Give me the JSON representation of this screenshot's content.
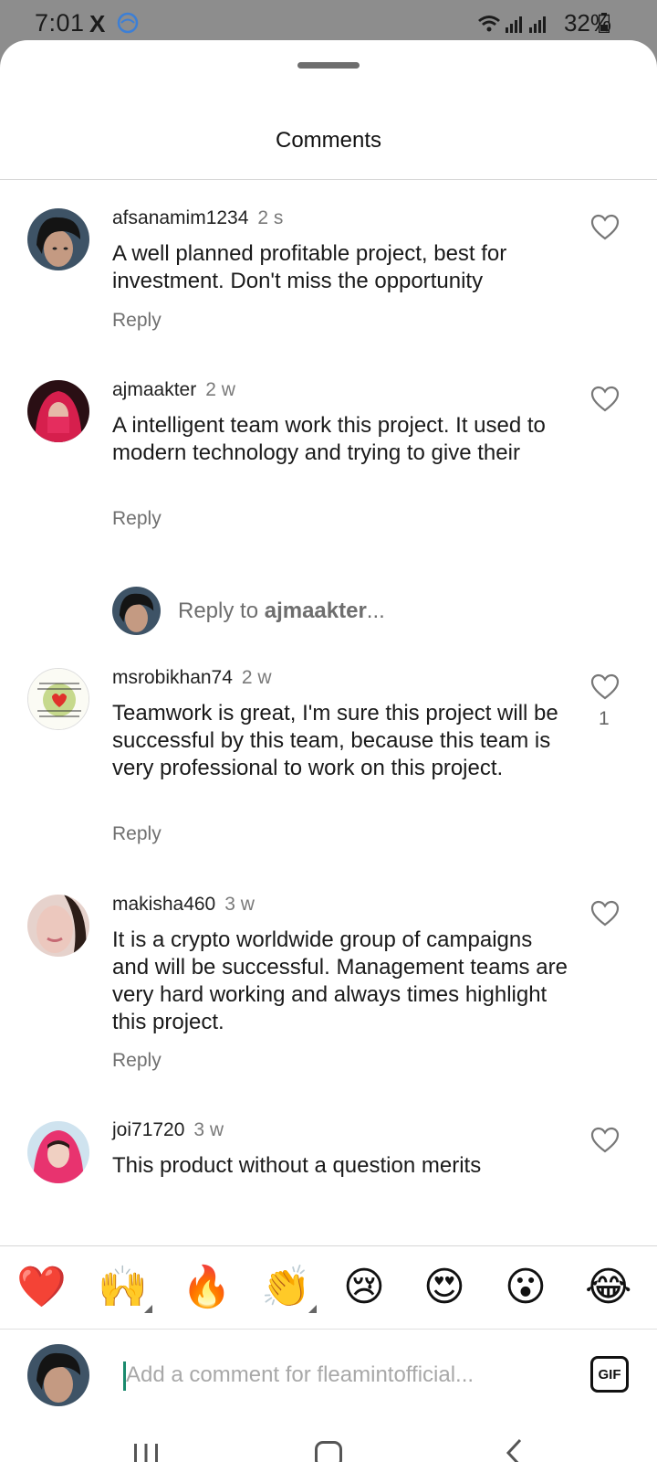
{
  "status_bar": {
    "time": "7:01",
    "x_icon": "X",
    "battery_percent": "32%",
    "icons": [
      "x-logo-icon",
      "browser-icon",
      "wifi-icon",
      "signal-icon",
      "signal-icon",
      "battery-icon"
    ]
  },
  "sheet": {
    "title": "Comments"
  },
  "comments": [
    {
      "username": "afsanamim1234",
      "time": "2 s",
      "text": "A well planned profitable project, best for investment. Don't miss the opportunity",
      "reply_label": "Reply",
      "likes": ""
    },
    {
      "username": "ajmaakter",
      "time": "2 w",
      "text": "A intelligent team work this project. It used to modern technology and trying to give their",
      "reply_label": "Reply",
      "likes": ""
    },
    {
      "username": "msrobikhan74",
      "time": "2 w",
      "text": "Teamwork is great, I'm sure this project will be successful by this team, because this team is very professional to work on this project.",
      "reply_label": "Reply",
      "likes": "1"
    },
    {
      "username": "makisha460",
      "time": "3 w",
      "text": "It is a crypto worldwide group of campaigns and will be successful. Management teams are very hard working and always times highlight this project.",
      "reply_label": "Reply",
      "likes": ""
    },
    {
      "username": "joi71720",
      "time": "3 w",
      "text": "This product without a question merits",
      "reply_label": "",
      "likes": ""
    }
  ],
  "reply_prompt": {
    "prefix": "Reply to ",
    "username": "ajmaakter",
    "suffix": "..."
  },
  "reactions": [
    "❤️",
    "🙌",
    "🔥",
    "👏",
    "😢",
    "😍",
    "😮",
    "😂"
  ],
  "composer": {
    "placeholder": "Add a comment for fleamintofficial...",
    "gif_label": "GIF"
  },
  "nav": {
    "icons": [
      "recent-apps-icon",
      "home-icon",
      "back-icon"
    ]
  }
}
